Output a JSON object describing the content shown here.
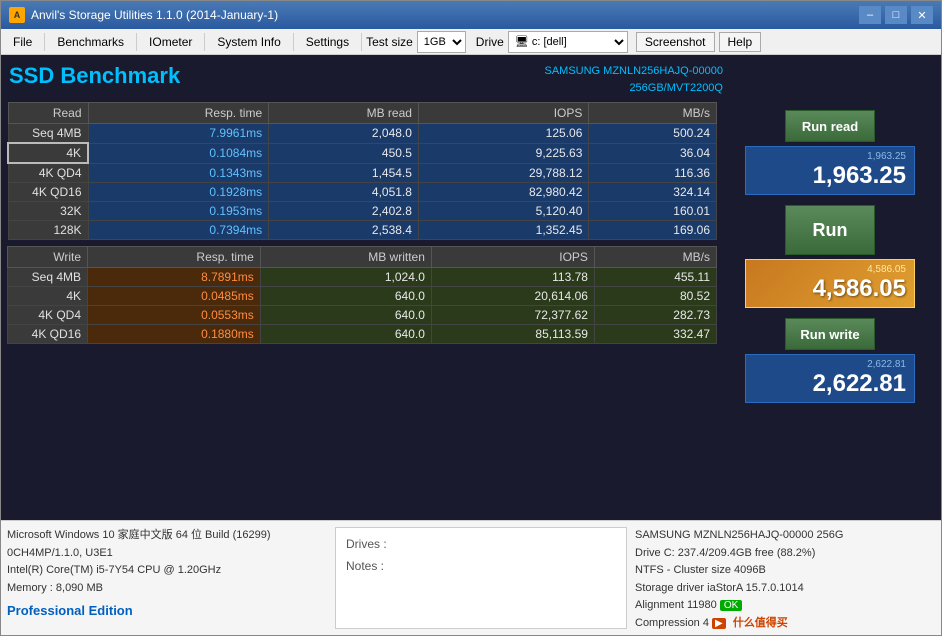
{
  "window": {
    "title": "Anvil's Storage Utilities 1.1.0 (2014-January-1)",
    "icon_label": "A"
  },
  "titlebar": {
    "minimize_label": "–",
    "maximize_label": "□",
    "close_label": "✕"
  },
  "menubar": {
    "file": "File",
    "benchmarks": "Benchmarks",
    "iometer": "IOmeter",
    "system_info": "System Info",
    "settings": "Settings",
    "test_size_label": "Test size",
    "test_size_value": "1GB",
    "drive_label": "Drive",
    "drive_value": "c: [dell]",
    "screenshot": "Screenshot",
    "help": "Help"
  },
  "header": {
    "ssd_title": "SSD Benchmark",
    "device_line1": "SAMSUNG MZNLN256HAJQ-00000",
    "device_line2": "256GB/MVT2200Q"
  },
  "read_table": {
    "headers": [
      "Read",
      "Resp. time",
      "MB read",
      "IOPS",
      "MB/s"
    ],
    "rows": [
      {
        "label": "Seq 4MB",
        "resp": "7.9961ms",
        "mb": "2,048.0",
        "iops": "125.06",
        "mbs": "500.24"
      },
      {
        "label": "4K",
        "resp": "0.1084ms",
        "mb": "450.5",
        "iops": "9,225.63",
        "mbs": "36.04",
        "highlight": true
      },
      {
        "label": "4K QD4",
        "resp": "0.1343ms",
        "mb": "1,454.5",
        "iops": "29,788.12",
        "mbs": "116.36"
      },
      {
        "label": "4K QD16",
        "resp": "0.1928ms",
        "mb": "4,051.8",
        "iops": "82,980.42",
        "mbs": "324.14"
      },
      {
        "label": "32K",
        "resp": "0.1953ms",
        "mb": "2,402.8",
        "iops": "5,120.40",
        "mbs": "160.01"
      },
      {
        "label": "128K",
        "resp": "0.7394ms",
        "mb": "2,538.4",
        "iops": "1,352.45",
        "mbs": "169.06"
      }
    ]
  },
  "write_table": {
    "headers": [
      "Write",
      "Resp. time",
      "MB written",
      "IOPS",
      "MB/s"
    ],
    "rows": [
      {
        "label": "Seq 4MB",
        "resp": "8.7891ms",
        "mb": "1,024.0",
        "iops": "113.78",
        "mbs": "455.11"
      },
      {
        "label": "4K",
        "resp": "0.0485ms",
        "mb": "640.0",
        "iops": "20,614.06",
        "mbs": "80.52"
      },
      {
        "label": "4K QD4",
        "resp": "0.0553ms",
        "mb": "640.0",
        "iops": "72,377.62",
        "mbs": "282.73"
      },
      {
        "label": "4K QD16",
        "resp": "0.1880ms",
        "mb": "640.0",
        "iops": "85,113.59",
        "mbs": "332.47"
      }
    ]
  },
  "scores": {
    "read_score_sub": "1,963.25",
    "read_score_main": "1,963.25",
    "overall_score_sub": "4,586.05",
    "overall_score_main": "4,586.05",
    "write_score_sub": "2,622.81",
    "write_score_main": "2,622.81"
  },
  "buttons": {
    "run_read": "Run read",
    "run": "Run",
    "run_write": "Run write"
  },
  "statusbar": {
    "os": "Microsoft Windows 10 家庭中文版 64 位 Build (16299)",
    "controller": "0CH4MP/1.1.0, U3E1",
    "cpu": "Intel(R) Core(TM) i5-7Y54 CPU @ 1.20GHz",
    "memory": "Memory : 8,090 MB",
    "professional": "Professional Edition",
    "drives_label": "Drives :",
    "notes_label": "Notes :",
    "device_full": "SAMSUNG MZNLN256HAJQ-00000 256G",
    "drive_c": "Drive C: 237.4/209.4GB free (88.2%)",
    "ntfs": "NTFS - Cluster size 4096B",
    "storage_driver": "Storage driver  iaStorA 15.7.0.1014",
    "alignment": "Alignment 11980",
    "alignment_ok": "OK",
    "compression": "Compression 4",
    "watermark": "什么值得买"
  }
}
